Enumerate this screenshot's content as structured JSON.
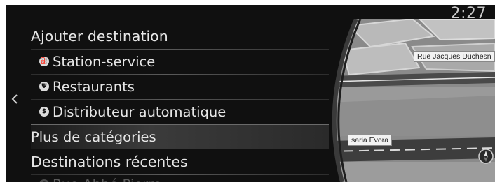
{
  "status_bar": {
    "time": "2:27"
  },
  "nav": {
    "back_icon": "chevron-left-icon"
  },
  "menu": {
    "items": [
      {
        "label": "Ajouter destination",
        "icon": null,
        "style": "heading"
      },
      {
        "label": "Station-service",
        "icon": "gas-station-icon",
        "style": "sub"
      },
      {
        "label": "Restaurants",
        "icon": "restaurant-icon",
        "style": "sub"
      },
      {
        "label": "Distributeur automatique",
        "icon": "atm-icon",
        "style": "sub"
      },
      {
        "label": "Plus de catégories",
        "icon": null,
        "style": "selected"
      },
      {
        "label": "Destinations récentes",
        "icon": null,
        "style": "heading"
      },
      {
        "label": "Rue Abbé Pierre",
        "icon": "history-icon",
        "style": "faded"
      }
    ]
  },
  "map": {
    "streets": [
      {
        "name": "Rue Jacques Duchesn"
      },
      {
        "name": "saria Evora"
      }
    ],
    "compass_icon": "compass-icon"
  },
  "colors": {
    "background": "#101010",
    "text": "#e6e6e6",
    "selected_bg": "#3b3b3b",
    "map_base": "#8c8c8c"
  }
}
